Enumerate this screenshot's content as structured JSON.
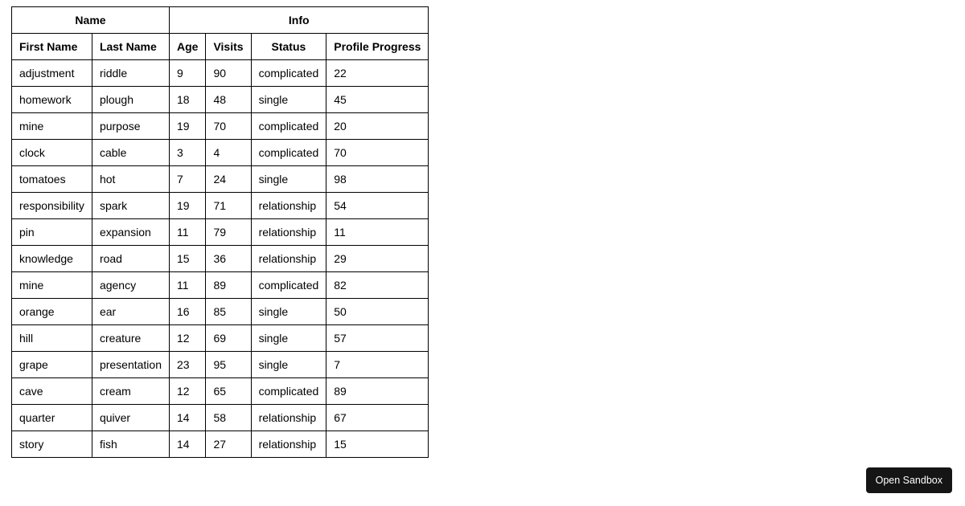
{
  "headers": {
    "group_name": "Name",
    "group_info": "Info",
    "first_name": "First Name",
    "last_name": "Last Name",
    "age": "Age",
    "visits": "Visits",
    "status": "Status",
    "progress": "Profile Progress"
  },
  "rows": [
    {
      "first_name": "adjustment",
      "last_name": "riddle",
      "age": "9",
      "visits": "90",
      "status": "complicated",
      "progress": "22"
    },
    {
      "first_name": "homework",
      "last_name": "plough",
      "age": "18",
      "visits": "48",
      "status": "single",
      "progress": "45"
    },
    {
      "first_name": "mine",
      "last_name": "purpose",
      "age": "19",
      "visits": "70",
      "status": "complicated",
      "progress": "20"
    },
    {
      "first_name": "clock",
      "last_name": "cable",
      "age": "3",
      "visits": "4",
      "status": "complicated",
      "progress": "70"
    },
    {
      "first_name": "tomatoes",
      "last_name": "hot",
      "age": "7",
      "visits": "24",
      "status": "single",
      "progress": "98"
    },
    {
      "first_name": "responsibility",
      "last_name": "spark",
      "age": "19",
      "visits": "71",
      "status": "relationship",
      "progress": "54"
    },
    {
      "first_name": "pin",
      "last_name": "expansion",
      "age": "11",
      "visits": "79",
      "status": "relationship",
      "progress": "11"
    },
    {
      "first_name": "knowledge",
      "last_name": "road",
      "age": "15",
      "visits": "36",
      "status": "relationship",
      "progress": "29"
    },
    {
      "first_name": "mine",
      "last_name": "agency",
      "age": "11",
      "visits": "89",
      "status": "complicated",
      "progress": "82"
    },
    {
      "first_name": "orange",
      "last_name": "ear",
      "age": "16",
      "visits": "85",
      "status": "single",
      "progress": "50"
    },
    {
      "first_name": "hill",
      "last_name": "creature",
      "age": "12",
      "visits": "69",
      "status": "single",
      "progress": "57"
    },
    {
      "first_name": "grape",
      "last_name": "presentation",
      "age": "23",
      "visits": "95",
      "status": "single",
      "progress": "7"
    },
    {
      "first_name": "cave",
      "last_name": "cream",
      "age": "12",
      "visits": "65",
      "status": "complicated",
      "progress": "89"
    },
    {
      "first_name": "quarter",
      "last_name": "quiver",
      "age": "14",
      "visits": "58",
      "status": "relationship",
      "progress": "67"
    },
    {
      "first_name": "story",
      "last_name": "fish",
      "age": "14",
      "visits": "27",
      "status": "relationship",
      "progress": "15"
    }
  ],
  "button": {
    "open_sandbox": "Open Sandbox"
  }
}
